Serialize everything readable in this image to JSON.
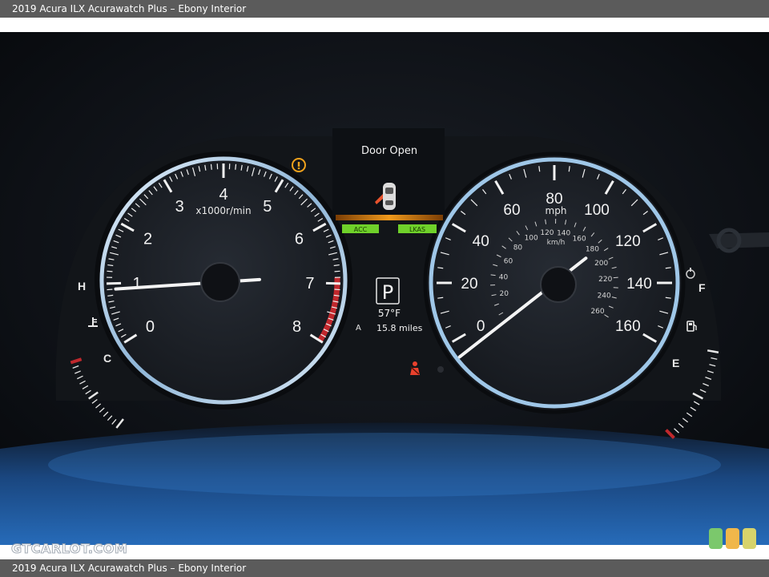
{
  "caption_top": "2019 Acura ILX Acurawatch Plus – Ebony Interior",
  "caption_bottom": "2019 Acura ILX Acurawatch Plus – Ebony Interior",
  "watermark": "GTCARLOT.COM",
  "tachometer": {
    "numbers": [
      "0",
      "1",
      "2",
      "3",
      "4",
      "5",
      "6",
      "7",
      "8"
    ],
    "unit": "x1000r/min",
    "reading": 1.0
  },
  "speedometer": {
    "mph_numbers": [
      "0",
      "20",
      "40",
      "60",
      "80",
      "100",
      "120",
      "140",
      "160"
    ],
    "unit_mph": "mph",
    "kmh_numbers": [
      "20",
      "40",
      "60",
      "80",
      "100",
      "120",
      "140",
      "160",
      "180",
      "200",
      "220",
      "240",
      "260"
    ],
    "unit_kmh": "km/h",
    "reading_mph": 0
  },
  "temp_gauge": {
    "hot": "H",
    "cold": "C"
  },
  "fuel_gauge": {
    "full": "F",
    "empty": "E"
  },
  "info_display": {
    "message": "Door Open",
    "acc": "ACC",
    "lkas": "LKAS",
    "gear": "P",
    "temperature": "57°F",
    "trip_label": "A",
    "trip": "15.8 miles"
  },
  "colors": {
    "ring_blue": "#9fc7e8",
    "redline": "#c0282d",
    "amber": "#f09a1c",
    "acc_green": "#6fd12a"
  }
}
